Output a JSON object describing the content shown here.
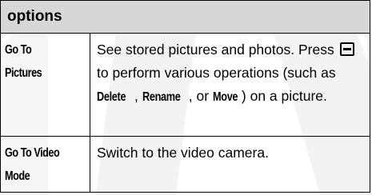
{
  "table": {
    "header": "options",
    "rows": [
      {
        "name_line1": "Go To",
        "name_line2": "Pictures",
        "desc_part1": "See stored pictures and photos. Press ",
        "key_icon": "menu-key-icon",
        "desc_part2": " to perform various operations (such as ",
        "cmd1": "Delete",
        "sep1": ", ",
        "cmd2": "Rename",
        "sep2": ", or ",
        "cmd3": "Move",
        "desc_part3": ") on a picture."
      },
      {
        "name_line1": "Go To Video",
        "name_line2": "Mode",
        "desc": "Switch to the video camera."
      }
    ]
  },
  "colors": {
    "header_bg": "#d7d7d7",
    "border": "#000000",
    "watermark": "#f2f2f2"
  }
}
